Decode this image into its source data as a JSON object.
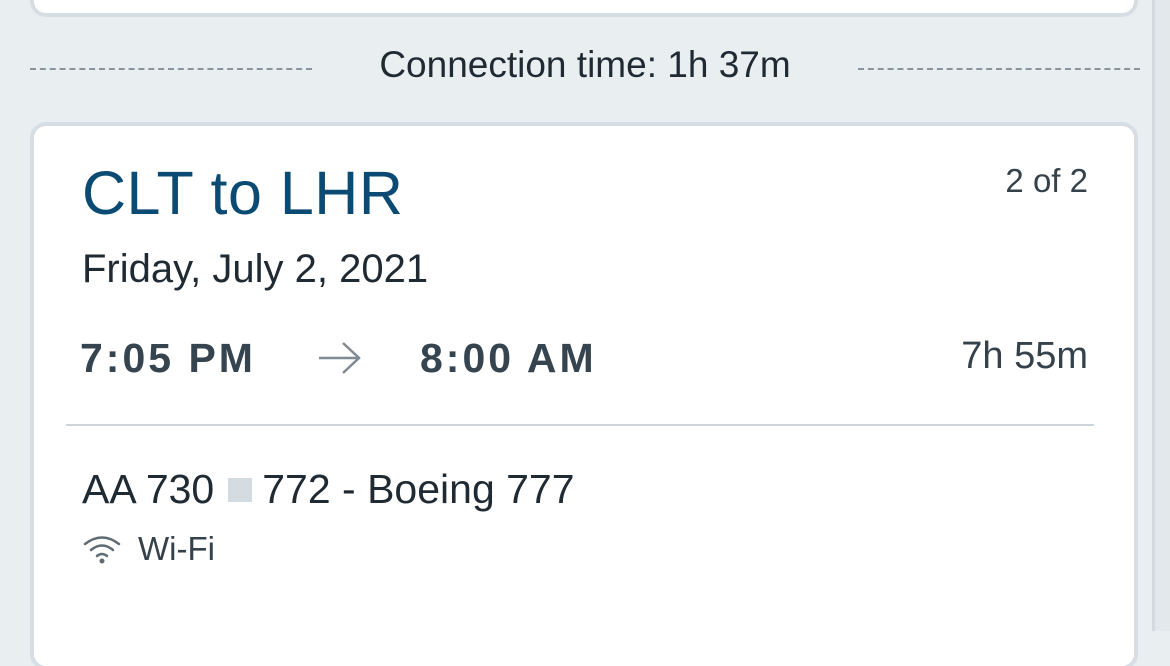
{
  "connection": {
    "text": "Connection time: 1h 37m"
  },
  "segment": {
    "route": "CLT to LHR",
    "count": "2 of 2",
    "date": "Friday, July 2, 2021",
    "departure_time": "7:05 PM",
    "arrival_time": "8:00 AM",
    "duration": "7h 55m",
    "flight_number": "AA 730",
    "aircraft": "772 - Boeing 777",
    "amenities": [
      {
        "icon": "wifi-icon",
        "label": "Wi-Fi"
      }
    ]
  },
  "colors": {
    "route_title": "#0b4a73",
    "background": "#e9eef0",
    "card": "#ffffff"
  }
}
